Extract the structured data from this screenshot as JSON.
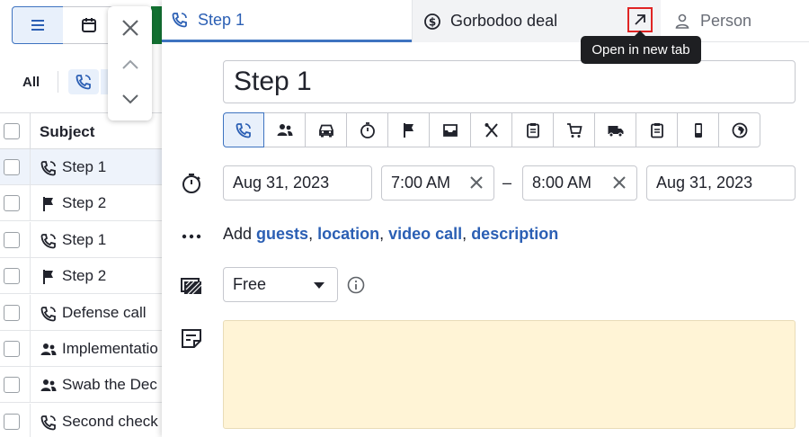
{
  "list": {
    "filter_all": "All",
    "header_subject": "Subject",
    "rows": [
      {
        "label": "Step 1",
        "icon": "phone-icon",
        "selected": true
      },
      {
        "label": "Step 2",
        "icon": "flag-icon"
      },
      {
        "label": "Step 1",
        "icon": "phone-icon"
      },
      {
        "label": "Step 2",
        "icon": "flag-icon"
      },
      {
        "label": "Defense call",
        "icon": "phone-icon"
      },
      {
        "label": "Implementatio",
        "icon": "meeting-icon"
      },
      {
        "label": "Swab the Dec",
        "icon": "meeting-icon"
      },
      {
        "label": "Second check",
        "icon": "phone-icon"
      }
    ]
  },
  "panel": {
    "tabs": [
      {
        "label": "Step 1",
        "icon": "phone-icon"
      },
      {
        "label": "Gorbodoo deal",
        "icon": "dollar-icon"
      },
      {
        "label": "Person",
        "icon": "person-icon"
      }
    ],
    "tooltip": "Open in new tab",
    "title_value": "Step 1",
    "start_date": "Aug 31, 2023",
    "start_time": "7:00 AM",
    "dash": "–",
    "end_time": "8:00 AM",
    "end_date": "Aug 31, 2023",
    "add_prefix": "Add",
    "add_links": {
      "guests": "guests",
      "location": "location",
      "video_call": "video call",
      "description": "description"
    },
    "availability": "Free",
    "colors": {
      "accent": "#2b5fb4",
      "note_bg": "#fff4d6",
      "highlight": "#e02424"
    }
  }
}
